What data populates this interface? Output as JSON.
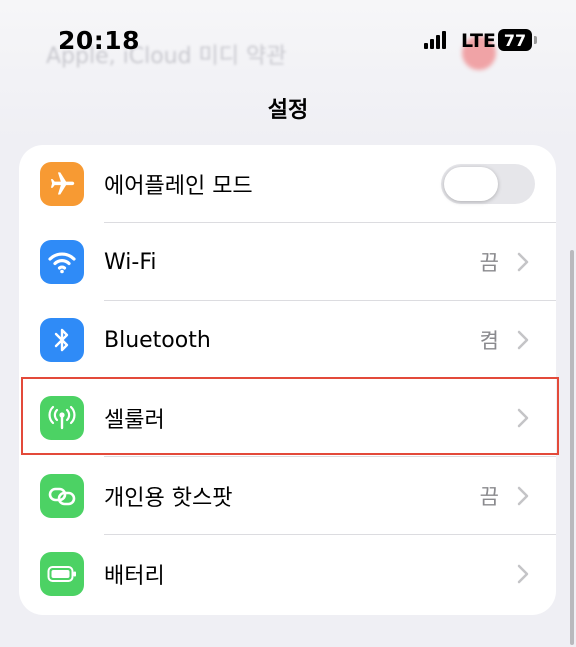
{
  "status_bar": {
    "time": "20:18",
    "network": "LTE",
    "battery": "77"
  },
  "background": {
    "ghost_text": "Apple, iCloud 미디 약관"
  },
  "header": {
    "title": "설정"
  },
  "settings": {
    "rows": [
      {
        "label": "에어플레인 모드",
        "icon": "airplane-icon",
        "color": "#f79a33",
        "toggle_on": false
      },
      {
        "label": "Wi-Fi",
        "value": "끔",
        "icon": "wifi-icon",
        "color": "#2f8bf7"
      },
      {
        "label": "Bluetooth",
        "value": "켬",
        "icon": "bluetooth-icon",
        "color": "#2f8bf7"
      },
      {
        "label": "셀룰러",
        "icon": "cellular-antenna-icon",
        "color": "#4cd264",
        "highlighted": true
      },
      {
        "label": "개인용 핫스팟",
        "value": "끔",
        "icon": "hotspot-link-icon",
        "color": "#4cd264"
      },
      {
        "label": "배터리",
        "icon": "battery-icon",
        "color": "#4cd264"
      }
    ]
  },
  "colors": {
    "highlight_border": "#e34a3a",
    "background": "#efeff4"
  }
}
